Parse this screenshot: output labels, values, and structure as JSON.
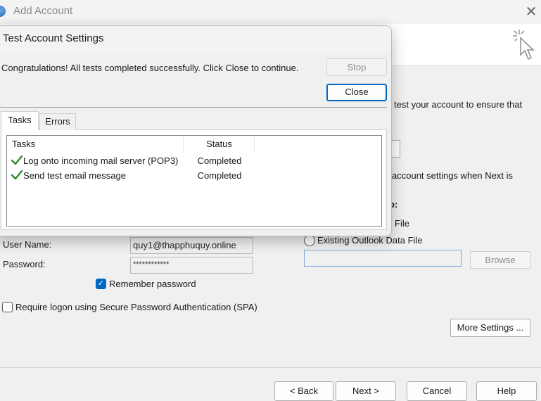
{
  "window": {
    "title": "Add Account",
    "close_glyph": "✕"
  },
  "background": {
    "frag_test_account": "test your account to ensure that",
    "frag_account_settings": "account settings when Next is",
    "frag_bold_o": "o:",
    "frag_file": "File",
    "user_name_label": "User Name:",
    "user_name_value": "quy1@thapphuquy.online",
    "password_label": "Password:",
    "password_value": "************",
    "remember_password_label": "Remember password",
    "remember_password_checked": true,
    "spa_label": "Require logon using Secure Password Authentication (SPA)",
    "existing_outlook_label": "Existing Outlook Data File",
    "browse_label": "Browse",
    "more_settings_label": "More Settings ..."
  },
  "footer": {
    "back_label": "< Back",
    "next_label": "Next >",
    "cancel_label": "Cancel",
    "help_label": "Help"
  },
  "dialog": {
    "title": "Test Account Settings",
    "message": "Congratulations! All tests completed successfully. Click Close to continue.",
    "stop_label": "Stop",
    "close_label": "Close",
    "tabs": [
      {
        "label": "Tasks",
        "active": true
      },
      {
        "label": "Errors",
        "active": false
      }
    ],
    "columns": {
      "tasks": "Tasks",
      "status": "Status"
    },
    "rows": [
      {
        "task": "Log onto incoming mail server (POP3)",
        "status": "Completed",
        "icon": "check-icon"
      },
      {
        "task": "Send test email message",
        "status": "Completed",
        "icon": "check-icon"
      }
    ]
  },
  "colors": {
    "accent": "#0067c0",
    "check_green": "#2e8b2e"
  }
}
